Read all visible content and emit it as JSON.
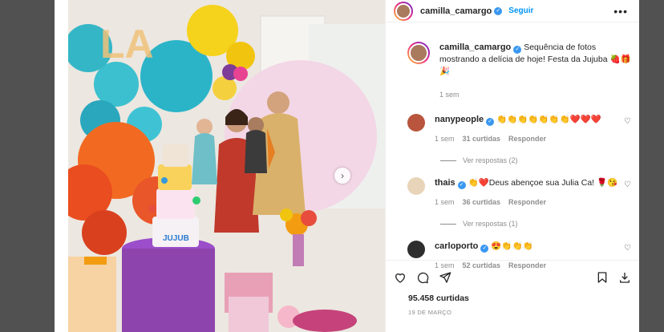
{
  "post": {
    "author": "camilla_camargo",
    "follow_label": "Seguir",
    "more_label": "•••",
    "caption": "Sequência de fotos mostrando a delícia de hoje! Festa da Jujuba 🍓🎁🎉",
    "caption_time": "1 sem",
    "likes": "95.458 curtidas",
    "date": "19 DE MARÇO"
  },
  "photo": {
    "cake_text": "JUJUB"
  },
  "comments": [
    {
      "user": "nanypeople",
      "text": "👏👏👏👏👏👏👏❤️❤️❤️",
      "time": "1 sem",
      "likes": "31 curtidas",
      "reply": "Responder",
      "view_replies": "Ver respostas (2)",
      "avatar_color": "#b8553c"
    },
    {
      "user": "thais",
      "text": "👏❤️Deus abençoe sua Julia Ca! 🌹😘",
      "time": "1 sem",
      "likes": "36 curtidas",
      "reply": "Responder",
      "view_replies": "Ver respostas (1)",
      "avatar_color": "#e8d4b8"
    },
    {
      "user": "carloporto",
      "text": "😍👏👏👏",
      "time": "1 sem",
      "likes": "52 curtidas",
      "reply": "Responder",
      "avatar_color": "#2e2e2e"
    }
  ],
  "icons": {
    "verified": "✓",
    "heart": "♡",
    "next": "›"
  }
}
